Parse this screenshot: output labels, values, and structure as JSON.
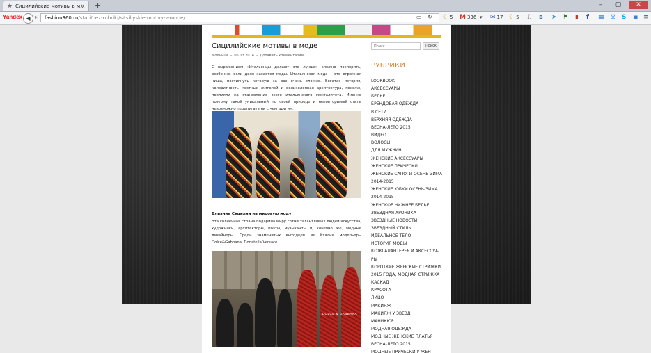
{
  "browser": {
    "tab_title": "Сицилийские мотивы в м...",
    "new_tab": "+",
    "brand": "Yandex",
    "url_domain": "fashion360.ru",
    "url_path": "/stati/bez-rubriki/sitsiliyskie-motivy-v-mode/",
    "ext": {
      "weather1": "5",
      "mail": "336",
      "letters": "17",
      "weather2": "5"
    }
  },
  "post": {
    "title": "Сицилийские мотивы в моде",
    "meta_author": "Модница",
    "meta_sep1": "–",
    "meta_date": "06.03.2014",
    "meta_sep2": "–",
    "meta_comment": "Добавить комментарий",
    "intro": "С выражением «Итальянцы делают это лучше» сложно поспорить, особенно, если дело касается моды. Итальянская мода – это огромная ниша, постигнуть которую за раз очень сложно. Богатая история, колоритность местных жителей и великолепная архитектура, похоже, повлияли на становление всего итальянского менталитета. Именно поэтому такой уникальный по своей природе и неповторимый стиль невозможно перепутать ни с чем другим.",
    "section_heading": "Влияние Сицилии на мировую моду",
    "section_text": "Эта солнечная страна подарила миру сотни талантливых людей искусства, художники, архитекторы, поэты, музыканты и, конечно же, модные дизайнеры. Среди знаменитых выходцев из Италии модельеры Dolce&Gabbana, Donatella Versace.",
    "photo2_logo": "DOLCE & GABBANA"
  },
  "sidebar": {
    "search_placeholder": "Поиск...",
    "search_button": "Поиск",
    "categories_heading": "РУБРИКИ",
    "categories": [
      "LOOKBOOK",
      "АКСЕССУАРЫ",
      "БЕЛЬЕ",
      "БРЕНДОВАЯ ОДЕЖДА",
      "В СЕТИ",
      "ВЕРХНЯЯ ОДЕЖДА",
      "ВЕСНА-ЛЕТО 2015",
      "ВИДЕО",
      "ВОЛОСЫ",
      "ДЛЯ МУЖЧИН",
      "ЖЕНСКИЕ АКСЕССУАРЫ",
      "ЖЕНСКИЕ ПРИЧЕСКИ",
      "ЖЕНСКИЕ САПОГИ ОСЕНЬ-ЗИМА",
      "2014-2015",
      "ЖЕНСКИЕ ЮБКИ ОСЕНЬ-ЗИМА",
      "2014-2015",
      "ЖЕНСКОЕ НИЖНЕЕ БЕЛЬЕ",
      "ЗВЕЗДНАЯ ХРОНИКА",
      "ЗВЕЗДНЫЕ НОВОСТИ",
      "ЗВЕЗДНЫЙ СТИЛЬ",
      "ИДЕАЛЬНОЕ ТЕЛО",
      "ИСТОРИЯ МОДЫ",
      "КОЖГАЛАНТЕРЕЯ И АКСЕССУА-",
      "РЫ",
      "КОРОТКИЕ ЖЕНСКИЕ СТРИЖКИ",
      "2015 ГОДА, МОДНАЯ СТРИЖКА",
      "КАСКАД",
      "КРАСОТА",
      "ЛИЦО",
      "МАКИЯЖ",
      "МАКИЯЖ У ЗВЕЗД",
      "МАНИКЮР",
      "МОДНАЯ ОДЕЖДА",
      "МОДНЫЕ ЖЕНСКИЕ ПЛАТЬЯ",
      "ВЕСНА-ЛЕТО 2015",
      "МОДНЫЕ ПРИЧЕСКИ У ЖЕН-"
    ]
  }
}
